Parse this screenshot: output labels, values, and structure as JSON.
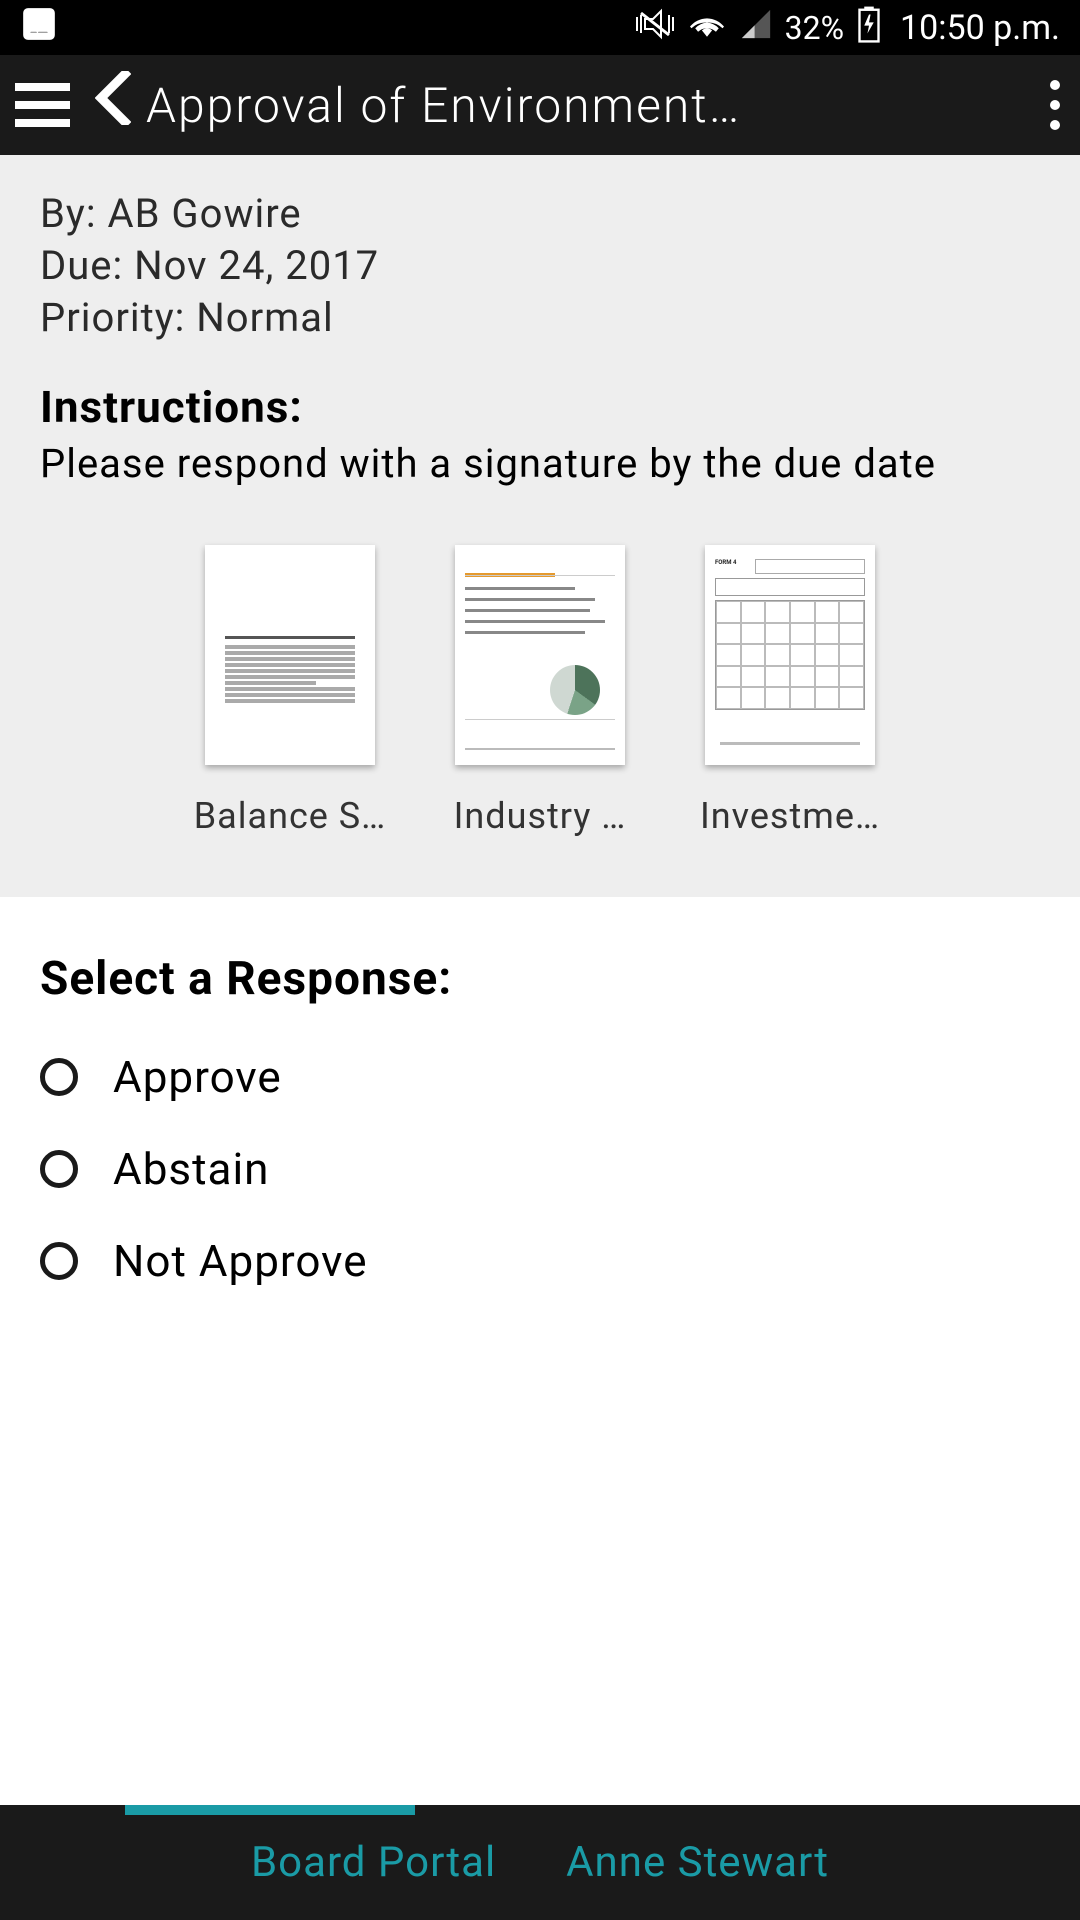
{
  "status_bar": {
    "battery_pct": "32%",
    "time": "10:50 p.m."
  },
  "header": {
    "title": "Approval of Environment…"
  },
  "meta": {
    "by_label": "By:",
    "by_value": "AB Gowire",
    "due_label": "Due:",
    "due_value": "Nov 24, 2017",
    "priority_label": "Priority:",
    "priority_value": "Normal"
  },
  "instructions": {
    "heading": "Instructions:",
    "body": "Please respond with a signature by the due date"
  },
  "attachments": [
    {
      "label": "Balance S…"
    },
    {
      "label": "Industry …"
    },
    {
      "label": "Investme…"
    }
  ],
  "response": {
    "heading": "Select a Response:",
    "options": [
      {
        "label": "Approve"
      },
      {
        "label": "Abstain"
      },
      {
        "label": "Not Approve"
      }
    ]
  },
  "footer": {
    "tab_board": "Board Portal",
    "tab_user": "Anne Stewart"
  }
}
